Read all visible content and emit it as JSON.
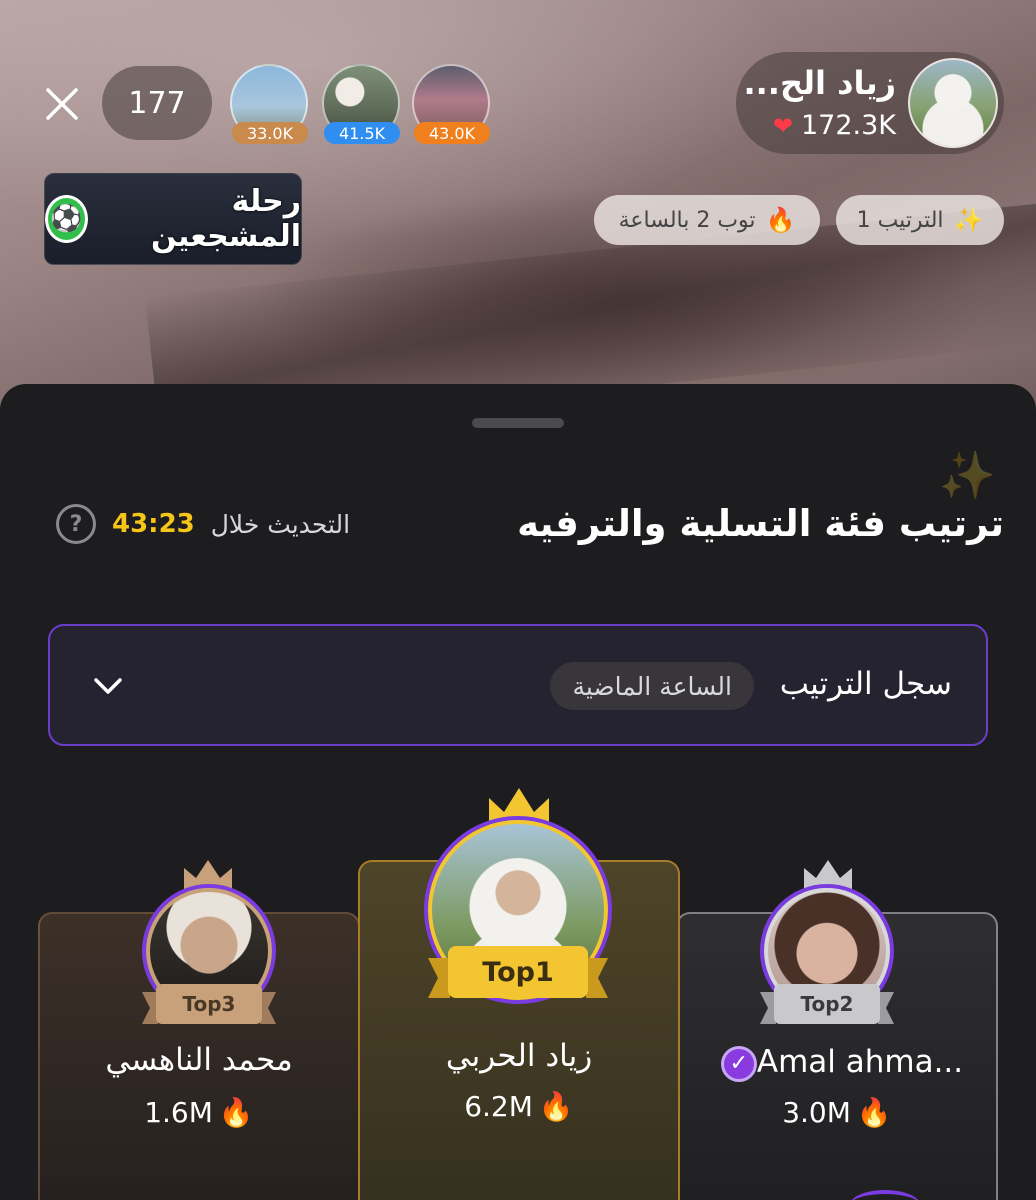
{
  "stream": {
    "viewer_count": "177",
    "top_viewers": [
      {
        "score": "33.0K",
        "color": "#c98a4b"
      },
      {
        "score": "41.5K",
        "color": "#2f8ef0"
      },
      {
        "score": "43.0K",
        "color": "#f07f1e"
      }
    ],
    "host": {
      "name": "زياد الح...",
      "likes": "172.3K"
    },
    "brand_logo_text": "رحلة المشجعين",
    "chips": {
      "rank": "الترتيب 1",
      "hourly": "توب 2 بالساعة"
    }
  },
  "sheet": {
    "title": "ترتيب فئة التسلية والترفيه",
    "refresh_label": "التحديث خلال",
    "refresh_timer": "43:23",
    "history_label": "سجل الترتيب",
    "history_tag": "الساعة الماضية"
  },
  "podium": [
    {
      "rank_label": "Top1",
      "name": "زياد الحربي",
      "score": "6.2M"
    },
    {
      "rank_label": "Top2",
      "name": "Amal ahma...",
      "score": "3.0M"
    },
    {
      "rank_label": "Top3",
      "name": "محمد الناهسي",
      "score": "1.6M"
    }
  ],
  "colors": {
    "gold": "#f2c531",
    "silver": "#c9c9cc",
    "bronze": "#c8a07a",
    "accent_purple": "#7a3be0",
    "timer_yellow": "#f5c518"
  }
}
